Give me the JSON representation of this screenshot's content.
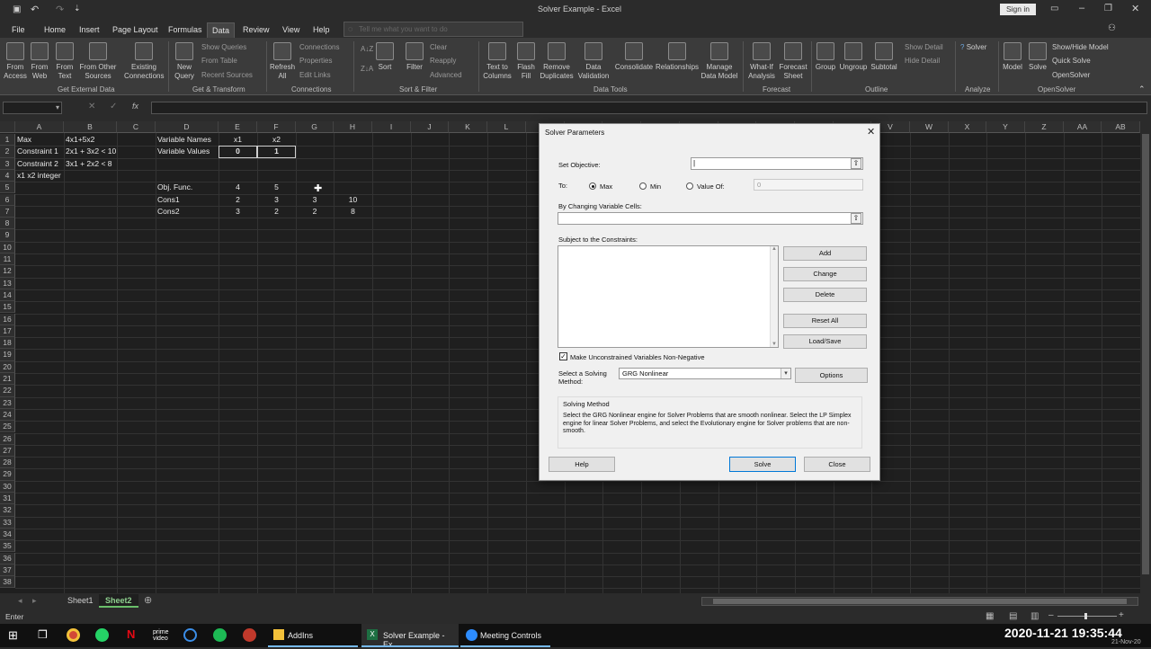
{
  "window": {
    "title": "Solver Example - Excel",
    "signin": "Sign in",
    "tell_me": "Tell me what you want to do"
  },
  "menu": [
    "File",
    "Home",
    "Insert",
    "Page Layout",
    "Formulas",
    "Data",
    "Review",
    "View",
    "Help"
  ],
  "active_menu": "Data",
  "ribbon": {
    "ext": {
      "access": "From\nAccess",
      "web": "From\nWeb",
      "text": "From\nText",
      "other": "From Other\nSources",
      "existing": "Existing\nConnections",
      "label": "Get External Data"
    },
    "transform": {
      "new_query": "New\nQuery",
      "show_queries": "Show Queries",
      "from_table": "From Table",
      "recent": "Recent Sources",
      "label": "Get & Transform"
    },
    "conn": {
      "refresh": "Refresh\nAll",
      "connections": "Connections",
      "properties": "Properties",
      "edit_links": "Edit Links",
      "label": "Connections"
    },
    "sort": {
      "sort": "Sort",
      "filter": "Filter",
      "clear": "Clear",
      "reapply": "Reapply",
      "advanced": "Advanced",
      "label": "Sort & Filter"
    },
    "tools": {
      "t2c": "Text to\nColumns",
      "flash": "Flash\nFill",
      "remove": "Remove\nDuplicates",
      "validation": "Data\nValidation",
      "consolidate": "Consolidate",
      "relationships": "Relationships",
      "manage": "Manage\nData Model",
      "label": "Data Tools"
    },
    "forecast": {
      "whatif": "What-If\nAnalysis",
      "sheet": "Forecast\nSheet",
      "label": "Forecast"
    },
    "outline": {
      "group": "Group",
      "ungroup": "Ungroup",
      "subtotal": "Subtotal",
      "show": "Show Detail",
      "hide": "Hide Detail",
      "label": "Outline"
    },
    "analyze": {
      "solver": "Solver",
      "label": "Analyze"
    },
    "opensolver": {
      "model": "Model",
      "solve": "Solve",
      "showhide": "Show/Hide Model",
      "quick": "Quick Solve",
      "os": "OpenSolver",
      "label": "OpenSolver"
    }
  },
  "columns": [
    "A",
    "B",
    "C",
    "D",
    "E",
    "F",
    "G",
    "H",
    "I",
    "J",
    "K",
    "L",
    "M",
    "N",
    "O",
    "P",
    "Q",
    "R",
    "S",
    "T",
    "U",
    "V",
    "W",
    "X",
    "Y",
    "Z",
    "AA",
    "AB"
  ],
  "rows": [
    "1",
    "2",
    "3",
    "4",
    "5",
    "6",
    "7",
    "8",
    "9",
    "10",
    "11",
    "12",
    "13",
    "14",
    "15",
    "16",
    "17",
    "18",
    "19",
    "20",
    "21",
    "22",
    "23",
    "24",
    "25",
    "26",
    "27",
    "28",
    "29",
    "30",
    "31",
    "32",
    "33",
    "34",
    "35",
    "36",
    "37",
    "38"
  ],
  "cells": {
    "A1": "Max",
    "B1": "4x1+5x2",
    "A2": "Constraint 1",
    "B2": "2x1 + 3x2 < 10",
    "A3": "Constraint 2",
    "B3": "3x1 + 2x2 < 8",
    "A4": "x1 x2 integer",
    "D1": "Variable Names",
    "E1": "x1",
    "F1": "x2",
    "D2": "Variable Values",
    "E2": "0",
    "F2": "1",
    "D5": "Obj. Func.",
    "E5": "4",
    "F5": "5",
    "D6": "Cons1",
    "E6": "2",
    "F6": "3",
    "G6": "3",
    "H6": "10",
    "D7": "Cons2",
    "E7": "3",
    "F7": "2",
    "G7": "2",
    "H7": "8"
  },
  "sheets": [
    "Sheet1",
    "Sheet2"
  ],
  "active_sheet": "Sheet2",
  "status": "Enter",
  "taskbar": {
    "addins": "AddIns",
    "excel": "Solver Example - Ex...",
    "meeting": "Meeting Controls",
    "clock": "2020-11-21 19:35:44",
    "date_small": "21-Nov-20"
  },
  "dialog": {
    "title": "Solver Parameters",
    "set_objective": "Set Objective:",
    "to": "To:",
    "max": "Max",
    "min": "Min",
    "value_of": "Value Of:",
    "value_default": "0",
    "changing": "By Changing Variable Cells:",
    "subject": "Subject to the Constraints:",
    "add": "Add",
    "change": "Change",
    "delete": "Delete",
    "reset": "Reset All",
    "loadsave": "Load/Save",
    "nonneg": "Make Unconstrained Variables Non-Negative",
    "select_method": "Select a Solving\nMethod:",
    "method": "GRG Nonlinear",
    "options": "Options",
    "method_heading": "Solving Method",
    "method_desc": "Select the GRG Nonlinear engine for Solver Problems that are smooth nonlinear. Select the LP Simplex engine for linear Solver Problems, and select the Evolutionary engine for Solver problems that are non-smooth.",
    "help": "Help",
    "solve": "Solve",
    "close": "Close"
  }
}
